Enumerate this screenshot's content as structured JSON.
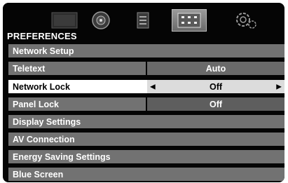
{
  "menu": {
    "title": "PREFERENCES",
    "tabs": [
      {
        "icon": "picture-icon"
      },
      {
        "icon": "sound-icon"
      },
      {
        "icon": "setup-icon"
      },
      {
        "icon": "preferences-icon",
        "active": true
      },
      {
        "icon": "settings-gear-icon"
      }
    ],
    "items": [
      {
        "label": "Network Setup"
      },
      {
        "label": "Teletext",
        "value": "Auto"
      },
      {
        "label": "Network Lock",
        "value": "Off",
        "selected": true
      },
      {
        "label": "Panel Lock",
        "value": "Off"
      },
      {
        "label": "Display Settings"
      },
      {
        "label": "AV Connection"
      },
      {
        "label": "Energy Saving Settings"
      },
      {
        "label": "Blue Screen"
      }
    ]
  },
  "colors": {
    "background": "#050505",
    "row": "#727272",
    "selected_row": "#ffffff",
    "text": "#ffffff"
  }
}
